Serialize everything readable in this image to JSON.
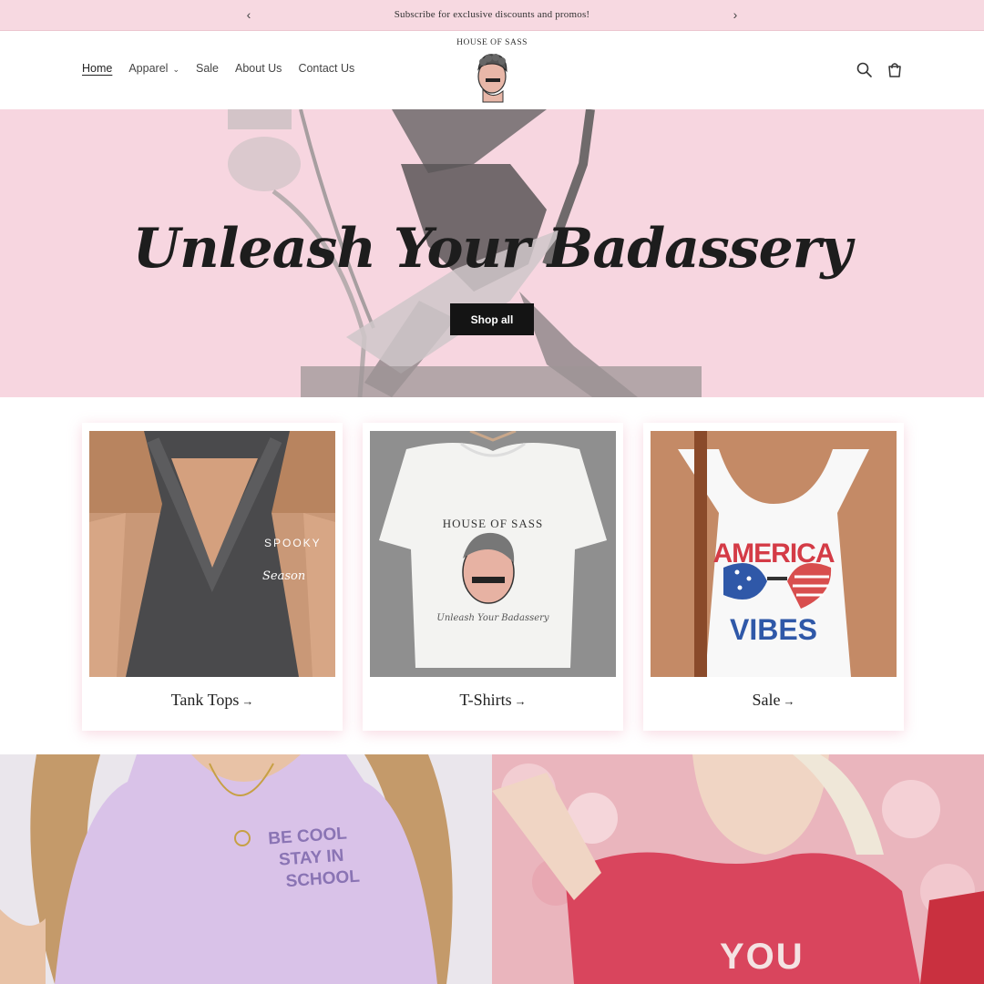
{
  "announcement": {
    "message": "Subscribe for exclusive discounts and promos!",
    "prev_icon": "chevron-left-icon",
    "next_icon": "chevron-right-icon"
  },
  "header": {
    "nav": [
      {
        "label": "Home",
        "active": true
      },
      {
        "label": "Apparel",
        "has_dropdown": true
      },
      {
        "label": "Sale"
      },
      {
        "label": "About Us"
      },
      {
        "label": "Contact Us"
      }
    ],
    "logo_text": "HOUSE OF SASS",
    "icons": [
      "search-icon",
      "cart-icon"
    ]
  },
  "hero": {
    "title": "Unleash Your Badassery",
    "button_label": "Shop all",
    "background_color": "#f7d6e0"
  },
  "collections": [
    {
      "label": "Tank Tops",
      "arrow": "→"
    },
    {
      "label": "T-Shirts",
      "arrow": "→",
      "shirt_print_top": "HOUSE OF SASS",
      "shirt_print_bottom": "Unleash Your Badassery"
    },
    {
      "label": "Sale",
      "arrow": "→",
      "shirt_print_top": "AMERICA",
      "shirt_print_bottom": "VIBES"
    }
  ],
  "tank_print": {
    "line1": "SPOOKY",
    "line2": "Season"
  },
  "banners": [
    {
      "print": [
        "BE COOL",
        "STAY IN",
        "SCHOOL"
      ]
    },
    {
      "print": [
        "YOU"
      ]
    }
  ],
  "colors": {
    "accent_pink": "#f7d9e1",
    "button_black": "#141414"
  }
}
